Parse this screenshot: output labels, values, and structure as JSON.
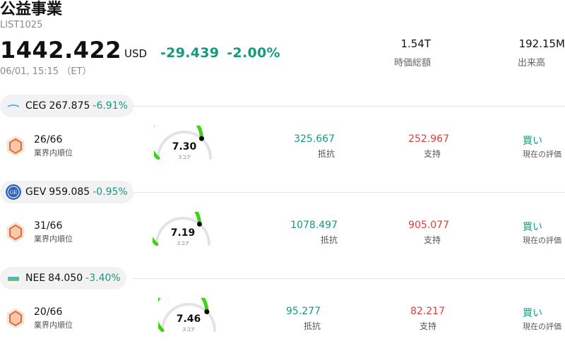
{
  "header": {
    "title": "公益事業",
    "code": "LIST1025",
    "price": "1442.422",
    "currency": "USD",
    "change": "-29.439",
    "change_pct": "-2.00%",
    "timestamp": "06/01, 15:15 （ET）",
    "market_cap_value": "1.54T",
    "market_cap_label": "時価総額",
    "volume_value": "192.15M",
    "volume_label": "出来高"
  },
  "labels": {
    "rank_label": "業界内順位",
    "score_label": "スコア",
    "resistance_label": "抵抗",
    "support_label": "支持",
    "rating_label": "現在の評価"
  },
  "colors": {
    "up": "#149b7f",
    "down": "#e03b3b",
    "gauge": "#3dd312",
    "gauge_track": "#e2e2ea"
  },
  "stocks": [
    {
      "ticker": "CEG",
      "price": "267.875",
      "pct": "-6.91%",
      "rank": "26/66",
      "score": "7.30",
      "score_value": 7.3,
      "resistance": "325.667",
      "support": "252.967",
      "rating": "買い",
      "logo_icon": "constellation-logo"
    },
    {
      "ticker": "GEV",
      "price": "959.085",
      "pct": "-0.95%",
      "rank": "31/66",
      "score": "7.19",
      "score_value": 7.19,
      "resistance": "1078.497",
      "support": "905.077",
      "rating": "買い",
      "logo_icon": "ge-vernova-logo"
    },
    {
      "ticker": "NEE",
      "price": "84.050",
      "pct": "-3.40%",
      "rank": "20/66",
      "score": "7.46",
      "score_value": 7.46,
      "resistance": "95.277",
      "support": "82.217",
      "rating": "買い",
      "logo_icon": "nextera-logo"
    }
  ]
}
